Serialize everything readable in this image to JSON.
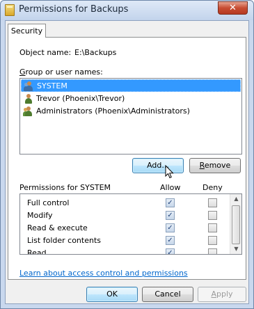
{
  "window": {
    "title": "Permissions for Backups",
    "close_glyph": "✕"
  },
  "tabs": [
    {
      "label": "Security"
    }
  ],
  "object": {
    "label": "Object name:",
    "value": "E:\\Backups"
  },
  "group_section": {
    "label": "Group or user names:"
  },
  "principals": [
    {
      "name": "SYSTEM",
      "icon": "group-icon",
      "selected": true
    },
    {
      "name": "Trevor (Phoenix\\Trevor)",
      "icon": "user-icon",
      "selected": false
    },
    {
      "name": "Administrators (Phoenix\\Administrators)",
      "icon": "group-icon",
      "selected": false
    }
  ],
  "buttons": {
    "add": "Add...",
    "remove": "Remove",
    "ok": "OK",
    "cancel": "Cancel",
    "apply": "Apply"
  },
  "permissions": {
    "header": "Permissions for SYSTEM",
    "allow_label": "Allow",
    "deny_label": "Deny",
    "rows": [
      {
        "name": "Full control",
        "allow": true,
        "deny": false
      },
      {
        "name": "Modify",
        "allow": true,
        "deny": false
      },
      {
        "name": "Read & execute",
        "allow": true,
        "deny": false
      },
      {
        "name": "List folder contents",
        "allow": true,
        "deny": false
      },
      {
        "name": "Read",
        "allow": true,
        "deny": false
      }
    ]
  },
  "link_text": "Learn about access control and permissions",
  "colors": {
    "selection": "#3399ff",
    "link": "#0066cc",
    "close": "#c74c32"
  }
}
